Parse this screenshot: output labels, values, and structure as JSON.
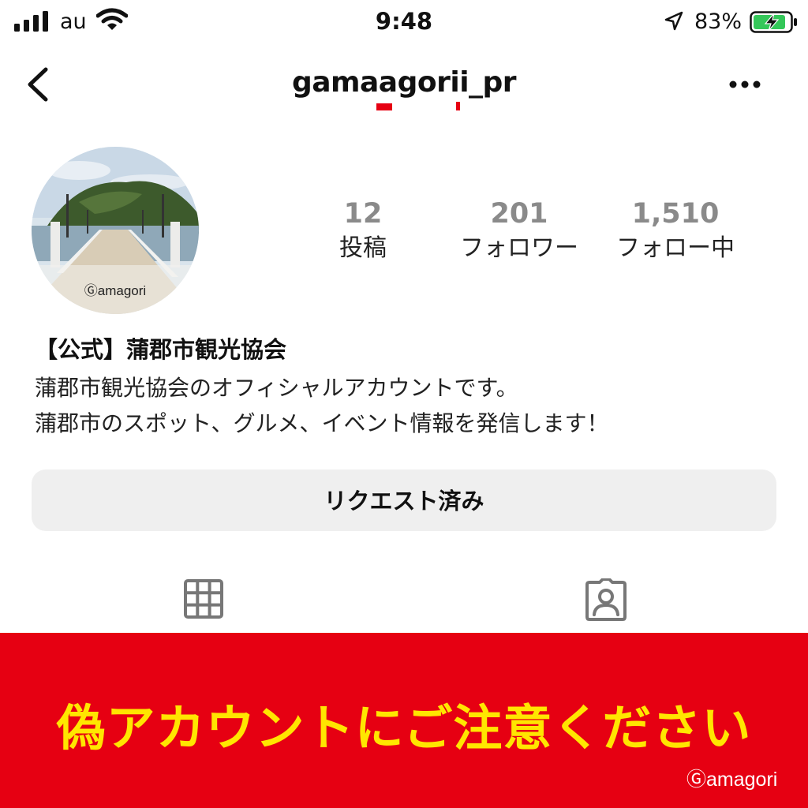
{
  "status_bar": {
    "carrier": "au",
    "time": "9:48",
    "battery_percent": "83%"
  },
  "header": {
    "username": "gamaagorii_pr"
  },
  "profile": {
    "avatar_watermark": "Ⓖamagori",
    "stats": [
      {
        "value": "12",
        "label": "投稿"
      },
      {
        "value": "201",
        "label": "フォロワー"
      },
      {
        "value": "1,510",
        "label": "フォロー中"
      }
    ],
    "full_name": "【公式】蒲郡市観光協会",
    "bio_lines": [
      "蒲郡市観光協会のオフィシャルアカウントです。",
      "蒲郡市のスポット、グルメ、イベント情報を発信します！"
    ],
    "request_button_label": "リクエスト済み"
  },
  "tabs": [
    {
      "icon": "grid-icon"
    },
    {
      "icon": "tagged-person-icon"
    }
  ],
  "banner": {
    "warning_text": "偽アカウントにご注意ください",
    "logo_text": "Ⓖamagori",
    "background_color": "#e60012",
    "text_color": "#ffe600"
  },
  "colors": {
    "accent_red": "#e60012",
    "battery_green": "#34c759"
  }
}
